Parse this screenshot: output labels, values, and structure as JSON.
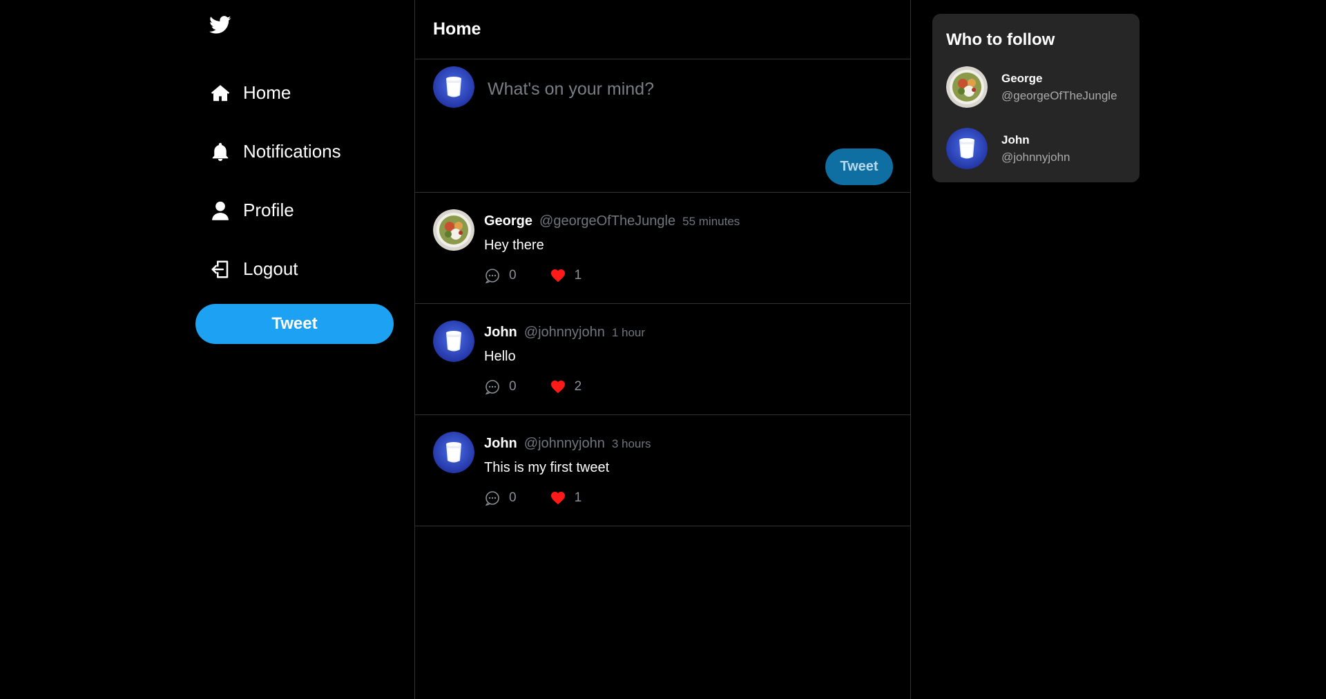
{
  "sidebar": {
    "logo": "twitter-bird-icon",
    "nav": [
      {
        "label": "Home",
        "icon": "home-icon"
      },
      {
        "label": "Notifications",
        "icon": "bell-icon"
      },
      {
        "label": "Profile",
        "icon": "user-icon"
      },
      {
        "label": "Logout",
        "icon": "logout-icon"
      }
    ],
    "tweet_button": "Tweet"
  },
  "feed": {
    "title": "Home",
    "composer": {
      "placeholder": "What's on your mind?",
      "tweet_button": "Tweet",
      "avatar": "milk-glass-avatar"
    },
    "tweets": [
      {
        "name": "George",
        "handle": "@georgeOfTheJungle",
        "time": "55 minutes",
        "text": "Hey there",
        "replies": "0",
        "likes": "1",
        "avatar": "food-bowl-avatar"
      },
      {
        "name": "John",
        "handle": "@johnnyjohn",
        "time": "1 hour",
        "text": "Hello",
        "replies": "0",
        "likes": "2",
        "avatar": "milk-glass-avatar"
      },
      {
        "name": "John",
        "handle": "@johnnyjohn",
        "time": "3 hours",
        "text": "This is my first tweet",
        "replies": "0",
        "likes": "1",
        "avatar": "milk-glass-avatar"
      }
    ]
  },
  "who_to_follow": {
    "title": "Who to follow",
    "users": [
      {
        "name": "George",
        "handle": "@georgeOfTheJungle",
        "avatar": "food-bowl-avatar"
      },
      {
        "name": "John",
        "handle": "@johnnyjohn",
        "avatar": "milk-glass-avatar"
      }
    ]
  },
  "colors": {
    "background": "#000000",
    "accent": "#1da1f2",
    "composer_button": "#0f6fa3",
    "like": "#ff1a1a",
    "card": "#262626",
    "muted": "#71767b"
  }
}
